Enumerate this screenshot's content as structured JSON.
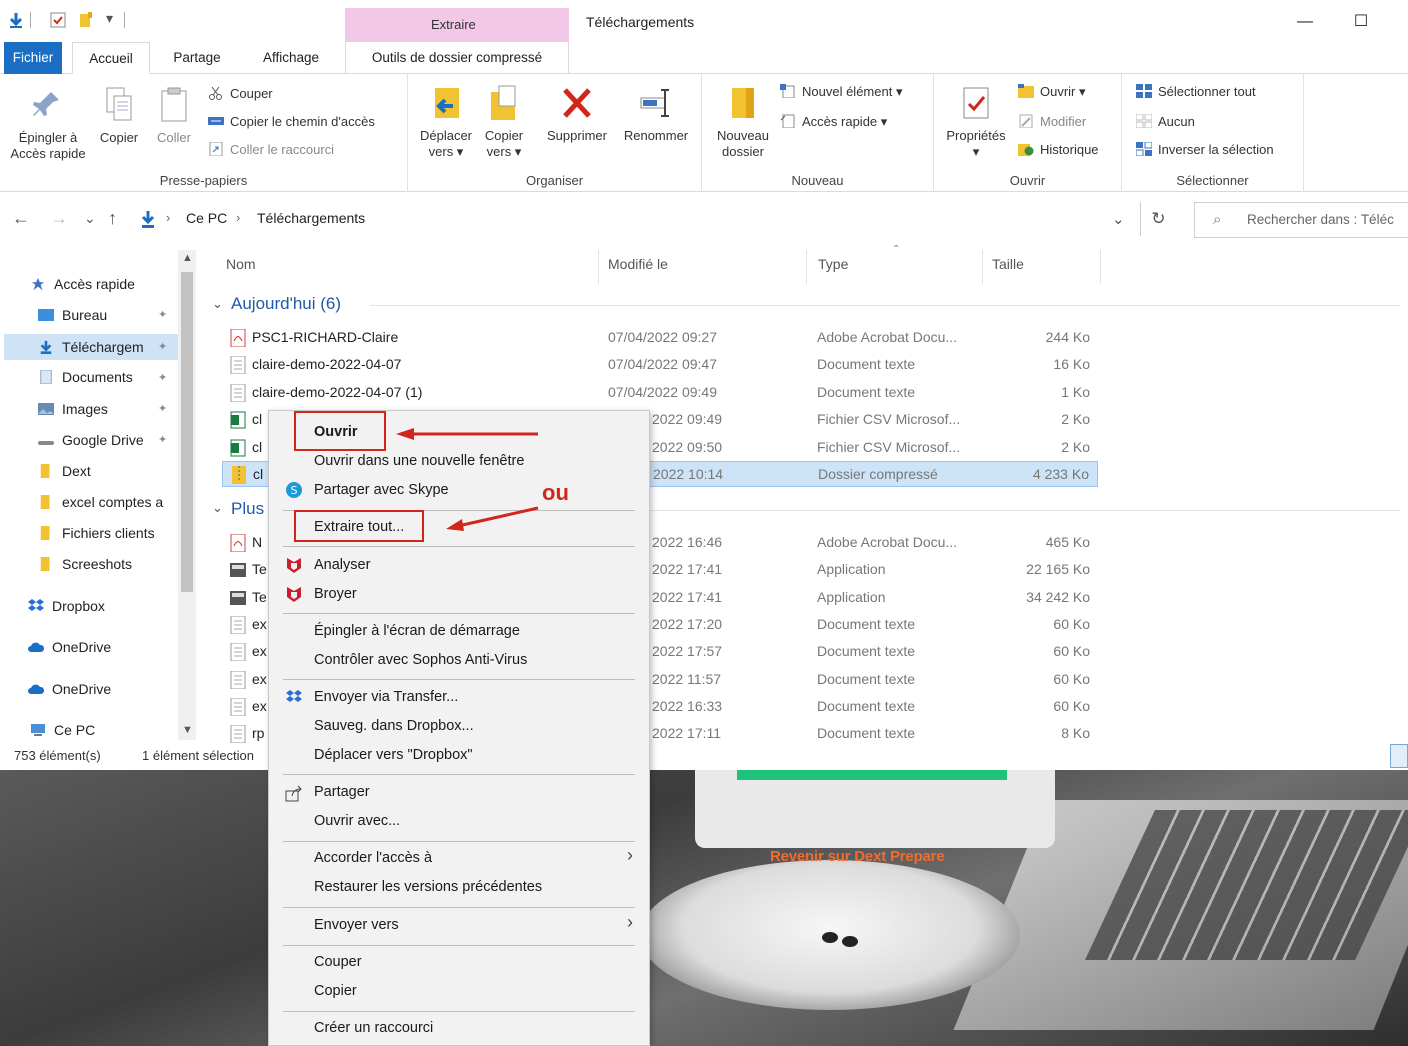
{
  "window": {
    "context_tab": "Extraire",
    "title": "Téléchargements",
    "minimize": "—",
    "maximize": "☐"
  },
  "tabs": [
    "Fichier",
    "Accueil",
    "Partage",
    "Affichage",
    "Outils de dossier compressé"
  ],
  "ribbon": {
    "presse_papiers": {
      "label": "Presse-papiers",
      "epingler": "Épingler à",
      "epingler2": "Accès rapide",
      "copier": "Copier",
      "coller": "Coller",
      "couper": "Couper",
      "copier_chemin": "Copier le chemin d'accès",
      "coller_raccourci": "Coller le raccourci"
    },
    "organiser": {
      "label": "Organiser",
      "deplacer": "Déplacer",
      "deplacer2": "vers ▾",
      "copier": "Copier",
      "copier2": "vers ▾",
      "supprimer": "Supprimer",
      "renommer": "Renommer"
    },
    "nouveau": {
      "label": "Nouveau",
      "dossier": "Nouveau",
      "dossier2": "dossier",
      "element": "Nouvel élément ▾",
      "acces": "Accès rapide ▾"
    },
    "ouvrir": {
      "label": "Ouvrir",
      "proprietes": "Propriétés",
      "proprietes2": "▾",
      "ouvrir": "Ouvrir ▾",
      "modifier": "Modifier",
      "historique": "Historique"
    },
    "selectionner": {
      "label": "Sélectionner",
      "tout": "Sélectionner tout",
      "aucun": "Aucun",
      "inverser": "Inverser la sélection"
    }
  },
  "address": {
    "back": "←",
    "forward": "→",
    "recent": "⌄",
    "up": "↑",
    "crumbs": [
      "Ce PC",
      "Téléchargements"
    ],
    "dropdown": "⌄",
    "refresh": "↻",
    "search_placeholder": "Rechercher dans : Téléc"
  },
  "nav": [
    "Accès rapide",
    "Bureau",
    "Téléchargem",
    "Documents",
    "Images",
    "Google Drive",
    "Dext",
    "excel comptes a",
    "Fichiers clients",
    "Screeshots",
    "Dropbox",
    "OneDrive",
    "OneDrive",
    "Ce PC"
  ],
  "columns": {
    "name": "Nom",
    "date": "Modifié le",
    "type": "Type",
    "size": "Taille"
  },
  "groups": {
    "today": "Aujourd'hui (6)",
    "older": "Plus"
  },
  "files_today": [
    {
      "name": "PSC1-RICHARD-Claire",
      "date": "07/04/2022 09:27",
      "type": "Adobe Acrobat Docu...",
      "size": "244 Ko"
    },
    {
      "name": "claire-demo-2022-04-07",
      "date": "07/04/2022 09:47",
      "type": "Document texte",
      "size": "16 Ko"
    },
    {
      "name": "claire-demo-2022-04-07 (1)",
      "date": "07/04/2022 09:49",
      "type": "Document texte",
      "size": "1 Ko"
    },
    {
      "name": "cl",
      "date": "2022 09:49",
      "type": "Fichier CSV Microsof...",
      "size": "2 Ko"
    },
    {
      "name": "cl",
      "date": "2022 09:50",
      "type": "Fichier CSV Microsof...",
      "size": "2 Ko"
    },
    {
      "name": "cl",
      "date": "2022 10:14",
      "type": "Dossier compressé",
      "size": "4 233 Ko"
    }
  ],
  "files_older": [
    {
      "name": "N",
      "date": "2022 16:46",
      "type": "Adobe Acrobat Docu...",
      "size": "465 Ko"
    },
    {
      "name": "Te",
      "date": "2022 17:41",
      "type": "Application",
      "size": "22 165 Ko"
    },
    {
      "name": "Te",
      "date": "2022 17:41",
      "type": "Application",
      "size": "34 242 Ko"
    },
    {
      "name": "ex",
      "date": "2022 17:20",
      "type": "Document texte",
      "size": "60 Ko"
    },
    {
      "name": "ex",
      "date": "2022 17:57",
      "type": "Document texte",
      "size": "60 Ko"
    },
    {
      "name": "ex",
      "date": "2022 11:57",
      "type": "Document texte",
      "size": "60 Ko"
    },
    {
      "name": "ex",
      "date": "2022 16:33",
      "type": "Document texte",
      "size": "60 Ko"
    },
    {
      "name": "rp",
      "date": "2022 17:11",
      "type": "Document texte",
      "size": "8 Ko"
    }
  ],
  "status": {
    "count": "753 élément(s)",
    "selected": "1 élément sélection"
  },
  "context_menu": {
    "ouvrir": "Ouvrir",
    "nouvelle_fenetre": "Ouvrir dans une nouvelle fenêtre",
    "skype": "Partager avec Skype",
    "extraire": "Extraire tout...",
    "analyser": "Analyser",
    "broyer": "Broyer",
    "epingler": "Épingler à l'écran de démarrage",
    "sophos": "Contrôler avec Sophos Anti-Virus",
    "transfer": "Envoyer via Transfer...",
    "sauveg": "Sauveg. dans Dropbox...",
    "deplacer_dropbox": "Déplacer vers \"Dropbox\"",
    "partager": "Partager",
    "ouvrir_avec": "Ouvrir avec...",
    "acces": "Accorder l'accès à",
    "restaurer": "Restaurer les versions précédentes",
    "envoyer": "Envoyer vers",
    "couper": "Couper",
    "copier": "Copier",
    "raccourci": "Créer un raccourci"
  },
  "annotation": {
    "ou": "ou"
  },
  "background": {
    "link": "Revenir sur Dext Prepare"
  },
  "colors": {
    "accent": "#1a6fc4",
    "annotation_red": "#d2261c",
    "selection": "#cde4f8",
    "context_tab": "#f2c8e6"
  }
}
